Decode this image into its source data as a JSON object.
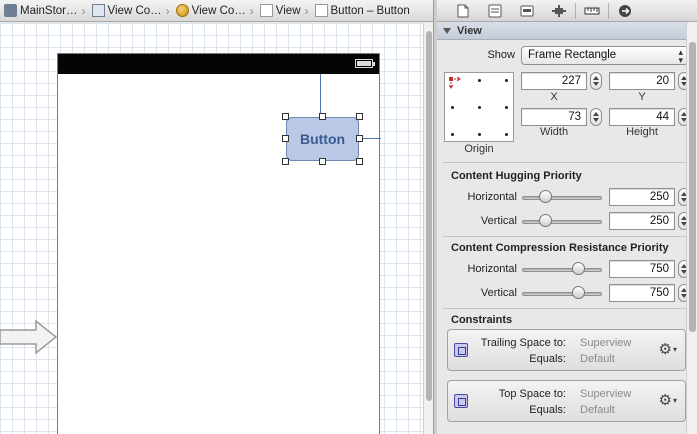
{
  "breadcrumb": [
    {
      "label": "MainStor…",
      "icon": "storyboard-icon"
    },
    {
      "label": "View Co…",
      "icon": "view-controller-scene-icon"
    },
    {
      "label": "View Co…",
      "icon": "view-controller-object-icon"
    },
    {
      "label": "View",
      "icon": "view-icon"
    },
    {
      "label": "Button – Button",
      "icon": "view-icon"
    }
  ],
  "canvas": {
    "button_label": "Button"
  },
  "inspector": {
    "tabs": [
      "file-icon",
      "quick-help-icon",
      "identity-icon",
      "attributes-icon",
      "size-icon",
      "connections-icon"
    ],
    "section_title": "View",
    "show_label": "Show",
    "show_value": "Frame Rectangle",
    "origin_label": "Origin",
    "x_label": "X",
    "y_label": "Y",
    "width_label": "Width",
    "height_label": "Height",
    "x": "227",
    "y": "20",
    "width": "73",
    "height": "44",
    "hugging": {
      "title": "Content Hugging Priority",
      "horizontal_label": "Horizontal",
      "vertical_label": "Vertical",
      "horizontal": "250",
      "vertical": "250",
      "horizontal_fraction": 0.25,
      "vertical_fraction": 0.25
    },
    "compression": {
      "title": "Content Compression Resistance Priority",
      "horizontal_label": "Horizontal",
      "vertical_label": "Vertical",
      "horizontal": "750",
      "vertical": "750",
      "horizontal_fraction": 0.75,
      "vertical_fraction": 0.75
    },
    "constraints": {
      "title": "Constraints",
      "items": [
        {
          "key": "Trailing Space to:",
          "value": "Superview",
          "equals_key": "Equals:",
          "equals_value": "Default"
        },
        {
          "key": "Top Space to:",
          "value": "Superview",
          "equals_key": "Equals:",
          "equals_value": "Default"
        }
      ]
    }
  },
  "colors": {
    "canvas_grid": "#dce5ee",
    "button_fill": "#b9c9e6",
    "constraint_line": "#4a77b4",
    "section_header": "#c4ccd8"
  }
}
